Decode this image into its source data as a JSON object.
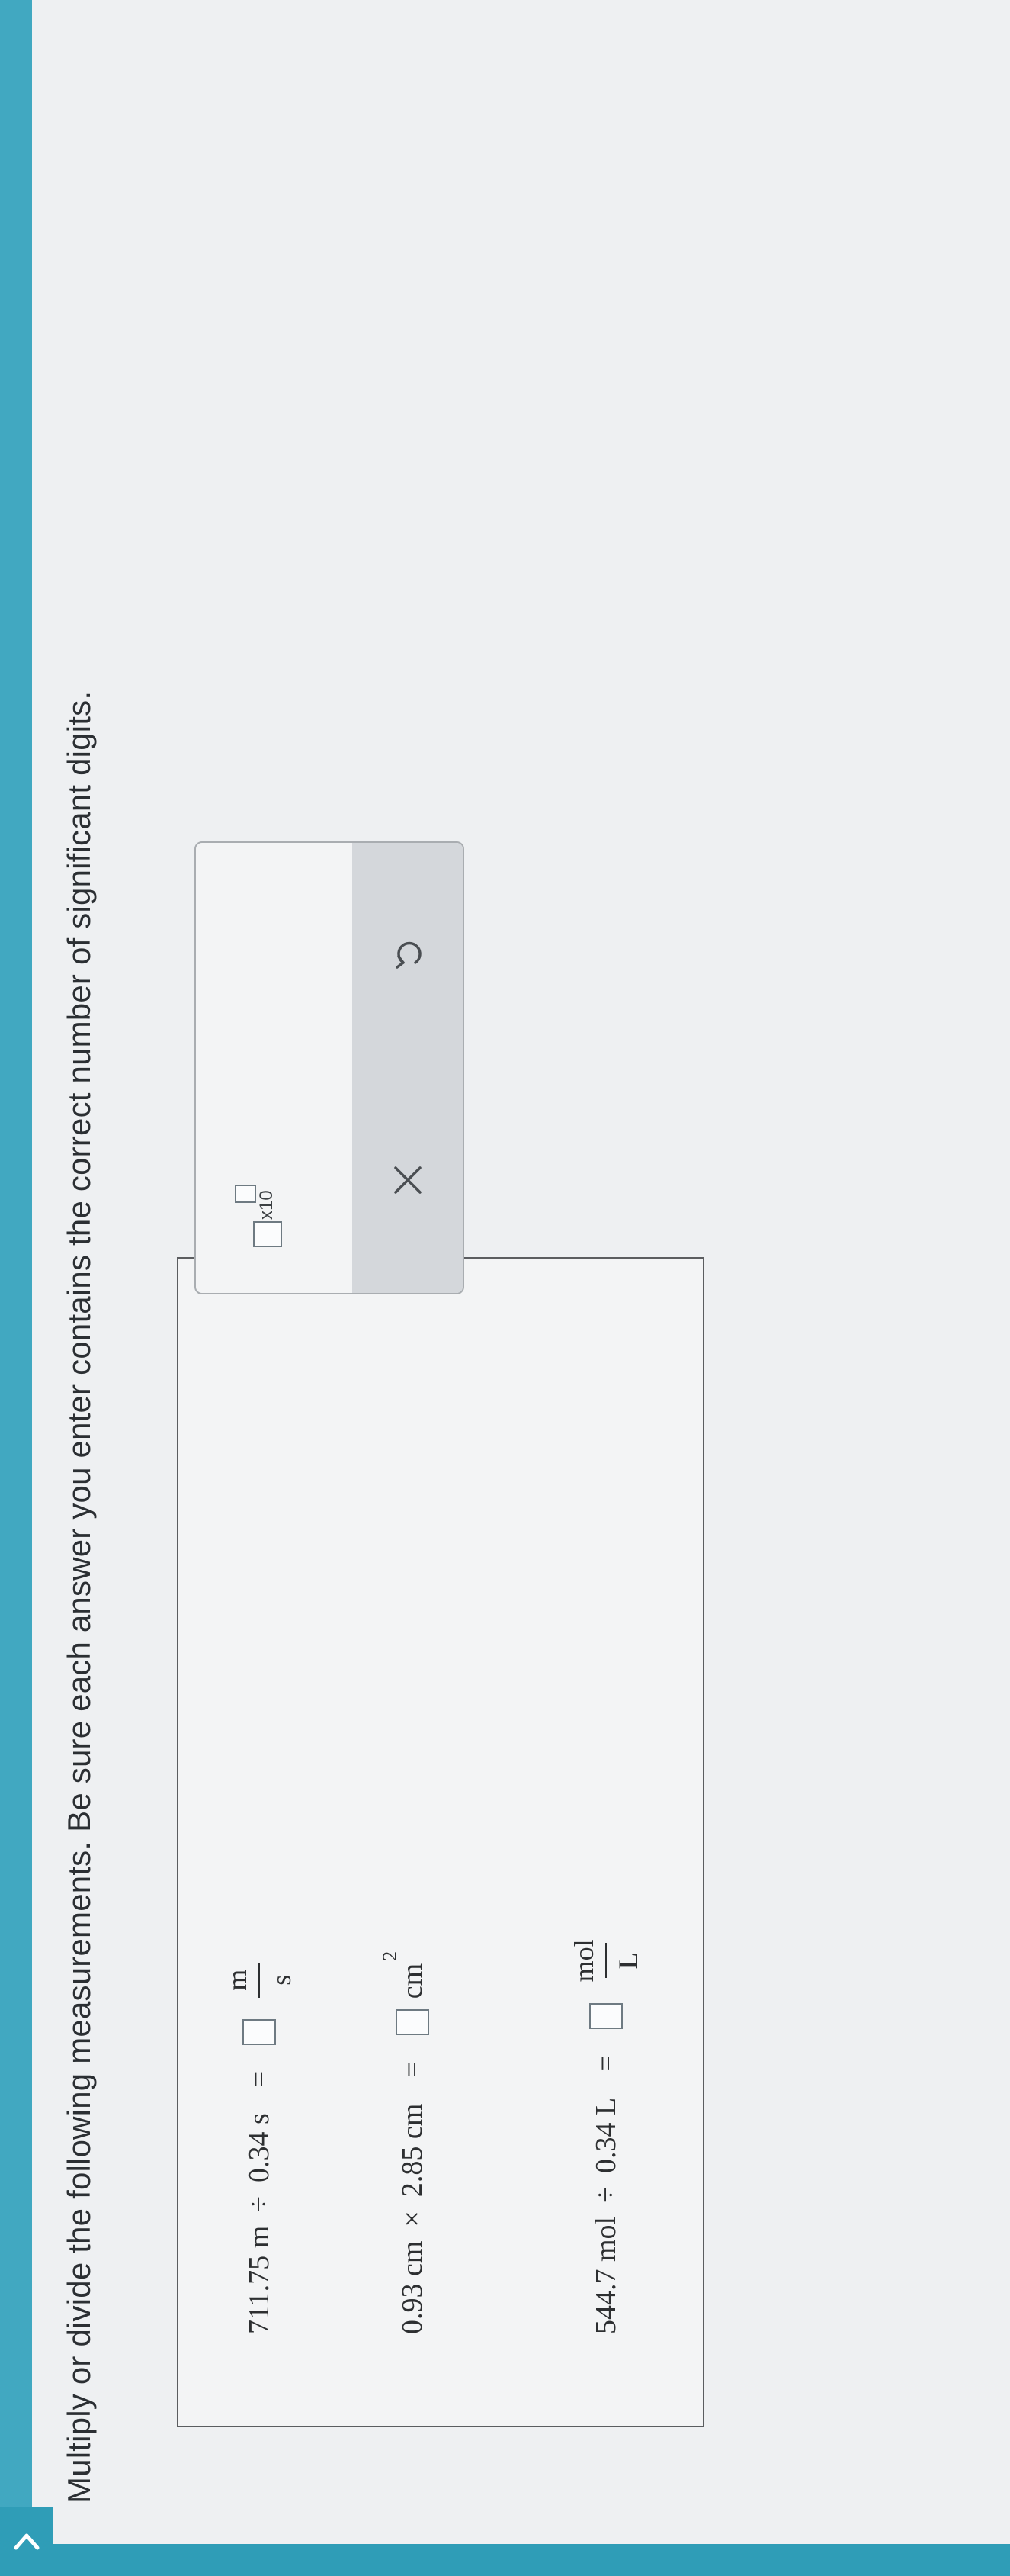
{
  "prompt": "Multiply or divide the following measurements. Be sure each answer you enter contains the correct number of significant digits.",
  "problems": [
    {
      "left": "711.75 m",
      "operator": "÷",
      "right": "0.34 s",
      "equals": "=",
      "unit_num": "m",
      "unit_den": "s"
    },
    {
      "left": "0.93 cm",
      "operator": "×",
      "right": "2.85 cm",
      "equals": "=",
      "unit": "cm",
      "unit_exp": "2"
    },
    {
      "left": "544.7 mol",
      "operator": "÷",
      "right": "0.34 L",
      "equals": "=",
      "unit_num": "mol",
      "unit_den": "L"
    }
  ],
  "tools": {
    "sci_label": "x10",
    "icons": [
      "scientific-notation-icon",
      "close-icon",
      "undo-icon"
    ]
  },
  "colors": {
    "accent": "#2f9db7",
    "panel_bar": "#d4d7db",
    "text": "#2b2f33"
  }
}
